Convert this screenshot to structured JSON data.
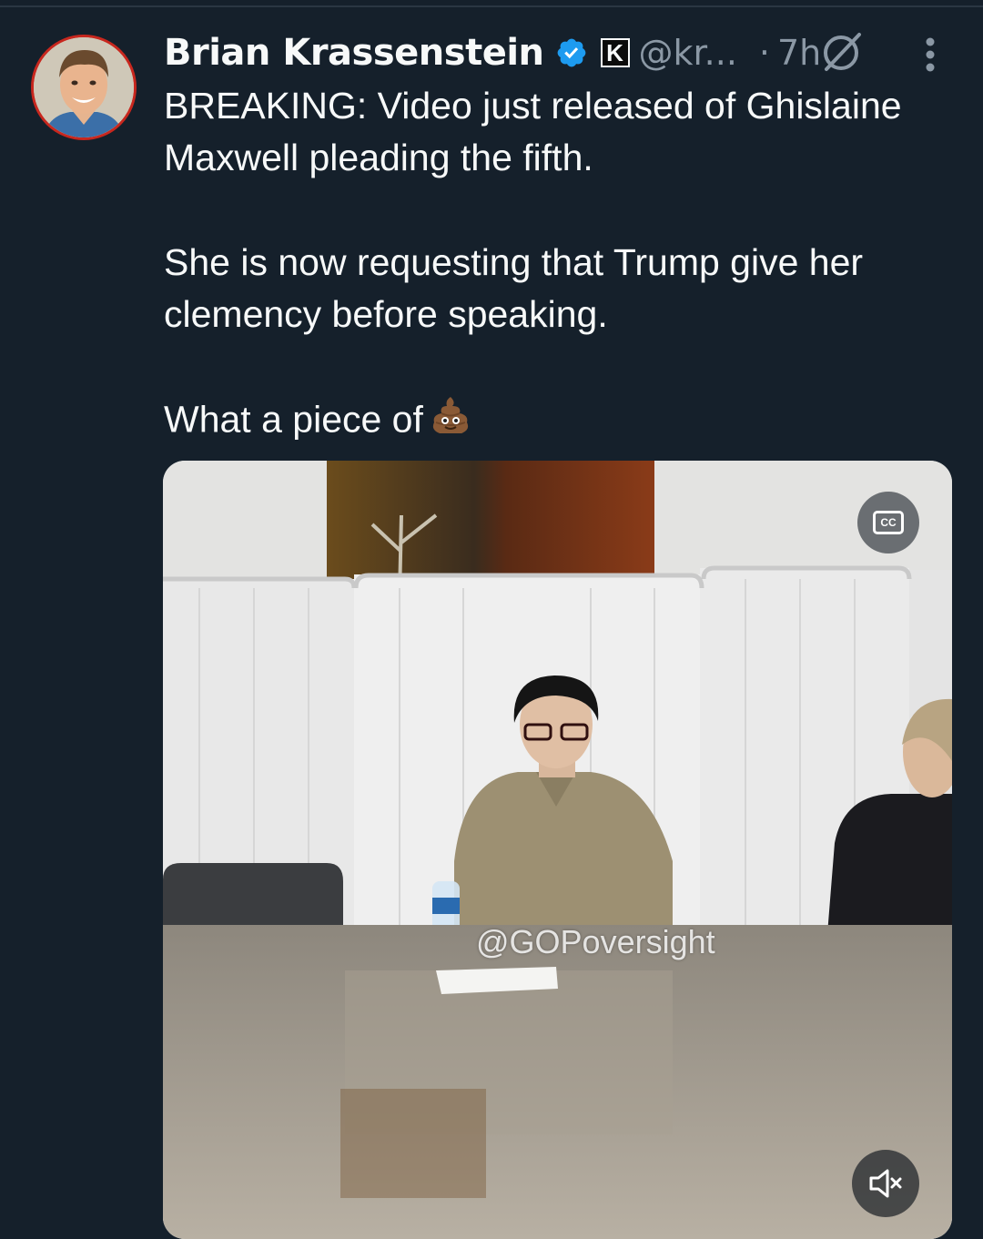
{
  "tweet": {
    "author_name": "Brian Krassenstein",
    "affiliate_badge": "K",
    "handle": "@kr...",
    "separator": "·",
    "time": "7h",
    "paragraphs": [
      "BREAKING: Video just released of Ghislaine Maxwell pleading the fifth.",
      "She is now requesting that Trump give her clemency before speaking.",
      "What a piece of"
    ]
  },
  "media": {
    "watermark": "@GOPoversight",
    "cc_label": "CC"
  },
  "icons": {
    "verified": "verified-badge-icon",
    "affiliate": "affiliate-k-badge-icon",
    "grok": "grok-icon",
    "more": "more-vertical-icon",
    "cc": "closed-captions-icon",
    "mute": "volume-muted-icon",
    "emoji": "poop-emoji-icon"
  },
  "colors": {
    "background": "#15202b",
    "text": "#f7f9f9",
    "secondary": "#8b98a5",
    "verified": "#1d9bf0",
    "avatar_ring": "#c8271e"
  }
}
